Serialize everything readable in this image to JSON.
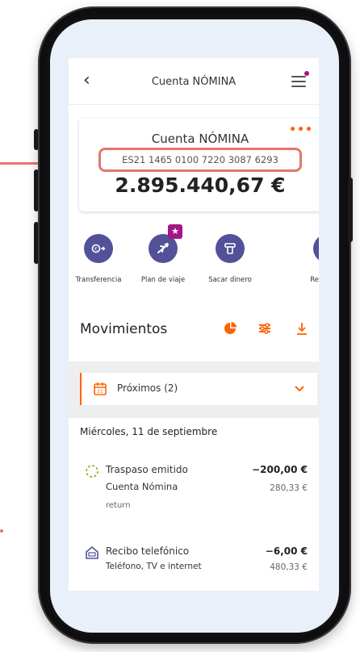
{
  "app": {
    "title": "Cuenta NÓMINA"
  },
  "account": {
    "name": "Cuenta NÓMINA",
    "iban": "ES21 1465 0100 7220 3087 6293",
    "balance": "2.895.440,67 €",
    "more_label": "•••"
  },
  "actions": [
    {
      "label": "Transferencia",
      "icon": "transfer-icon"
    },
    {
      "label": "Plan de viaje",
      "icon": "plane-icon",
      "badge": "★"
    },
    {
      "label": "Sacar dinero",
      "icon": "atm-icon"
    },
    {
      "label": "Reci",
      "icon": "receipt-icon"
    }
  ],
  "movements": {
    "title": "Movimientos",
    "upcoming_label": "Próximos (2)",
    "date": "Miércoles, 11 de septiembre",
    "items": [
      {
        "name": "Traspaso emitido",
        "sub": "Cuenta Nómina",
        "note": "return",
        "amount": "−200,00 €",
        "balance": "280,33 €",
        "icon": "pending-circle-icon"
      },
      {
        "name": "Recibo telefónico",
        "sub": "Teléfono, TV e internet",
        "amount": "−6,00 €",
        "balance": "480,33 €",
        "icon": "house-icon"
      }
    ]
  },
  "colors": {
    "accent": "#ff6200",
    "brand_purple": "#525199",
    "badge": "#a3178a",
    "highlight": "#e8746d"
  }
}
